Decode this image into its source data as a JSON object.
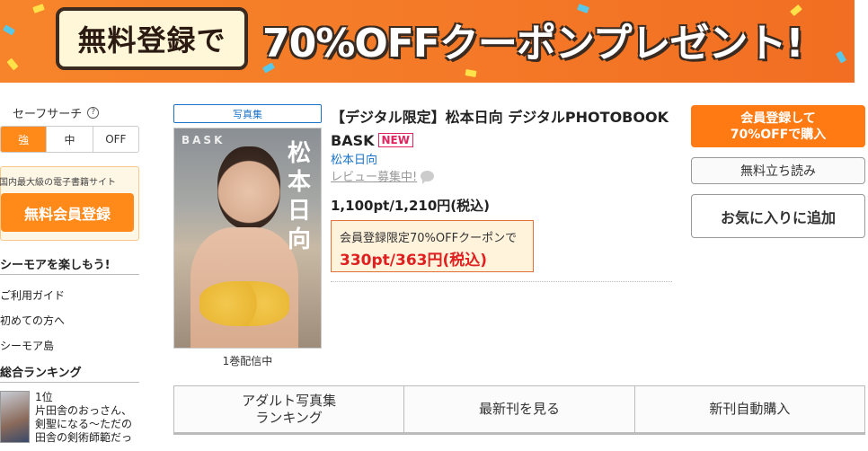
{
  "banner": {
    "left_text": "無料登録で",
    "headline": "70%OFFクーポンプレゼント!"
  },
  "sidebar": {
    "safe_search_label": "セーフサーチ",
    "help_symbol": "?",
    "safe_search_options": [
      "強",
      "中",
      "OFF"
    ],
    "safe_search_selected": "強",
    "promo_text": "国内最大級の電子書籍サイト",
    "register_button": "無料会員登録",
    "enjoy_heading": "シーモアを楽しもう!",
    "links": [
      "ご利用ガイド",
      "初めての方へ",
      "シーモア島"
    ],
    "ranking_heading": "総合ランキング",
    "ranking_item": {
      "rank": "1位",
      "title": "片田舎のおっさん、剣聖になる〜ただの田舎の剣術師範だっ"
    }
  },
  "product": {
    "tag": "写真集",
    "cover_text_bask": "BASK",
    "cover_text_name": "松本日向",
    "volume_text": "1巻配信中",
    "title": "【デジタル限定】松本日向 デジタルPHOTOBOOK BASK",
    "new_badge": "NEW",
    "author": "松本日向",
    "review_text": "レビュー募集中!",
    "price": "1,100pt/1,210円(税込)",
    "coupon_line": "会員登録限定70%OFFクーポンで",
    "coupon_price": "330pt/363円(税込)"
  },
  "actions": {
    "primary_line1": "会員登録して",
    "primary_line2": "70%OFFで購入",
    "trial_read": "無料立ち読み",
    "favorite": "お気に入りに追加"
  },
  "tabs": [
    "アダルト写真集\nランキング",
    "最新刊を見る",
    "新刊自動購入"
  ],
  "colors": {
    "accent_orange": "#ff7a12",
    "link_blue": "#1a73c8",
    "sale_red": "#e02020",
    "new_pink": "#e0245e"
  }
}
